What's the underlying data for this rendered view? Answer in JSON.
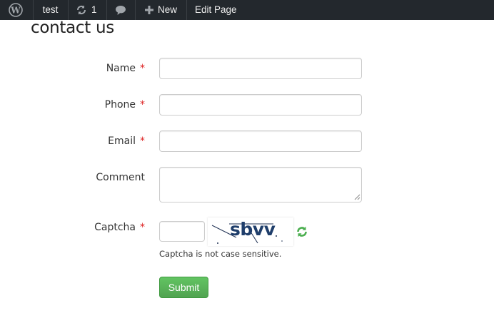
{
  "admin_bar": {
    "site_name": "test",
    "updates_count": "1",
    "new_label": "New",
    "edit_label": "Edit Page"
  },
  "page": {
    "title": "contact us"
  },
  "form": {
    "fields": [
      {
        "label": "Name",
        "required_mark": "*",
        "value": ""
      },
      {
        "label": "Phone",
        "required_mark": "*",
        "value": ""
      },
      {
        "label": "Email",
        "required_mark": "*",
        "value": ""
      },
      {
        "label": "Comment",
        "value": ""
      }
    ],
    "captcha": {
      "label": "Captcha",
      "required_mark": "*",
      "value": "",
      "image_text": "sbvv",
      "note": "Captcha is not case sensitive."
    },
    "submit_label": "Submit"
  },
  "colors": {
    "admin_bar": "#23282d",
    "submit": "#5bb75b",
    "required": "#dd2222"
  }
}
